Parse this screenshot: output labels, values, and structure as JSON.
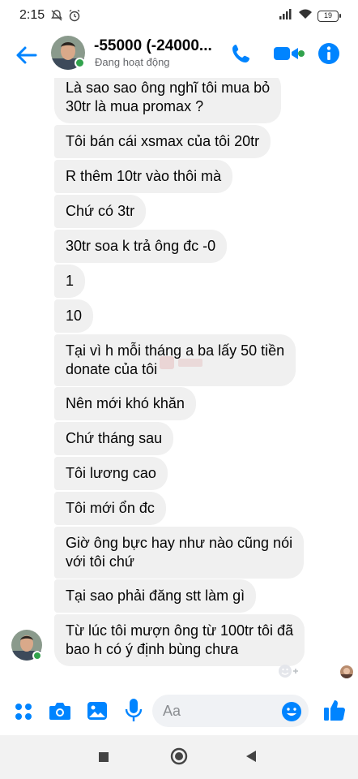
{
  "status_bar": {
    "time": "2:15",
    "battery": "19",
    "icons": [
      "mute-icon",
      "alarm-icon",
      "signal-icon",
      "wifi-icon",
      "battery-icon"
    ]
  },
  "header": {
    "contact_name": "-55000 (-24000...",
    "status": "Đang hoạt động",
    "accent_color": "#0084ff",
    "online_color": "#31a24c"
  },
  "messages": [
    {
      "text": "Là sao sao ông nghĩ tôi mua bỏ\n30tr là mua promax ?"
    },
    {
      "text": "Tôi bán cái xsmax của tôi 20tr"
    },
    {
      "text": "R thêm 10tr vào thôi mà"
    },
    {
      "text": "Chứ có 3tr"
    },
    {
      "text": "30tr soa k trả ông đc -0"
    },
    {
      "text": "1"
    },
    {
      "text": "10"
    },
    {
      "text": "Tại vì h mỗi tháng a ba lấy 50 tiền\ndonate của tôi"
    },
    {
      "text": "Nên mới khó khăn"
    },
    {
      "text": "Chứ tháng sau"
    },
    {
      "text": "Tôi lương cao"
    },
    {
      "text": "Tôi mới ổn đc"
    },
    {
      "text": "Giờ ông bực hay như nào cũng nói\nvới tôi chứ"
    },
    {
      "text": "Tại sao phải đăng stt làm gì"
    },
    {
      "text": "Từ lúc tôi mượn ông từ 100tr tôi đã\nbao h có ý định bùng chưa"
    }
  ],
  "composer": {
    "placeholder": "Aa"
  },
  "navbar": {
    "icons": [
      "recent-apps-icon",
      "home-icon",
      "back-nav-icon"
    ]
  }
}
